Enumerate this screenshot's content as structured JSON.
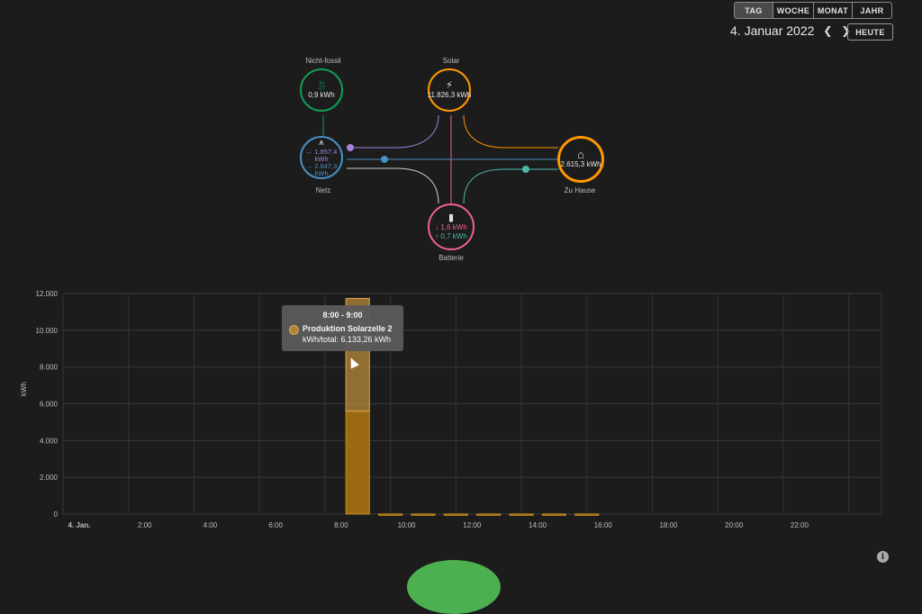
{
  "period": {
    "tabs": [
      "TAG",
      "WOCHE",
      "MONAT",
      "JAHR"
    ],
    "active": "TAG"
  },
  "date": {
    "label": "4. Januar 2022",
    "today_label": "HEUTE"
  },
  "flow": {
    "non_fossil": {
      "title": "Nicht-fossil",
      "value": "0,9 kWh",
      "color": "#0f9d58"
    },
    "solar": {
      "title": "Solar",
      "value": "11.826,3 kWh",
      "color": "#ff9800"
    },
    "grid": {
      "title": "Netz",
      "in": "← 1.857,4 kWh",
      "in_a": "← 1.857,4",
      "in_b": "kWh",
      "out_a": "→ 2.647,3",
      "out_b": "kWh",
      "color": "#488fc2",
      "in_color": "#a280db"
    },
    "home": {
      "title": "Zu Hause",
      "value": "2.615,3 kWh",
      "color": "#ff9800"
    },
    "battery": {
      "title": "Batterie",
      "in": "↓ 1,6 kWh",
      "out": "↑ 0,7 kWh",
      "color": "#f06292",
      "out_color": "#4db6ac"
    }
  },
  "chart_data": {
    "type": "bar",
    "ylabel": "kWh",
    "ylim": [
      0,
      12000
    ],
    "yticks": [
      "0",
      "2.000",
      "4.000",
      "6.000",
      "8.000",
      "10.000",
      "12.000"
    ],
    "xticks": [
      "4. Jan.",
      "2:00",
      "4:00",
      "6:00",
      "8:00",
      "10:00",
      "12:00",
      "14:00",
      "16:00",
      "18:00",
      "20:00",
      "22:00"
    ],
    "series": [
      {
        "name": "Produktion Solarzelle 2",
        "color": "#b8893c",
        "values": [
          0,
          0,
          0,
          0,
          0,
          0,
          0,
          0,
          6133.26,
          0,
          0,
          0,
          0,
          0,
          0,
          0,
          0,
          0,
          0,
          0,
          0,
          0,
          0,
          0
        ]
      },
      {
        "color": "#c28a1e",
        "values": [
          0,
          0,
          0,
          0,
          0,
          0,
          0,
          0,
          5600,
          5,
          5,
          5,
          5,
          5,
          5,
          5,
          0,
          0,
          0,
          0,
          0,
          0,
          0,
          0
        ]
      }
    ]
  },
  "tooltip": {
    "title": "8:00 - 9:00",
    "line1": "Produktion Solarzelle 2",
    "line2": "kWh/total: 6.133,26 kWh"
  },
  "info_icon": "info-icon"
}
